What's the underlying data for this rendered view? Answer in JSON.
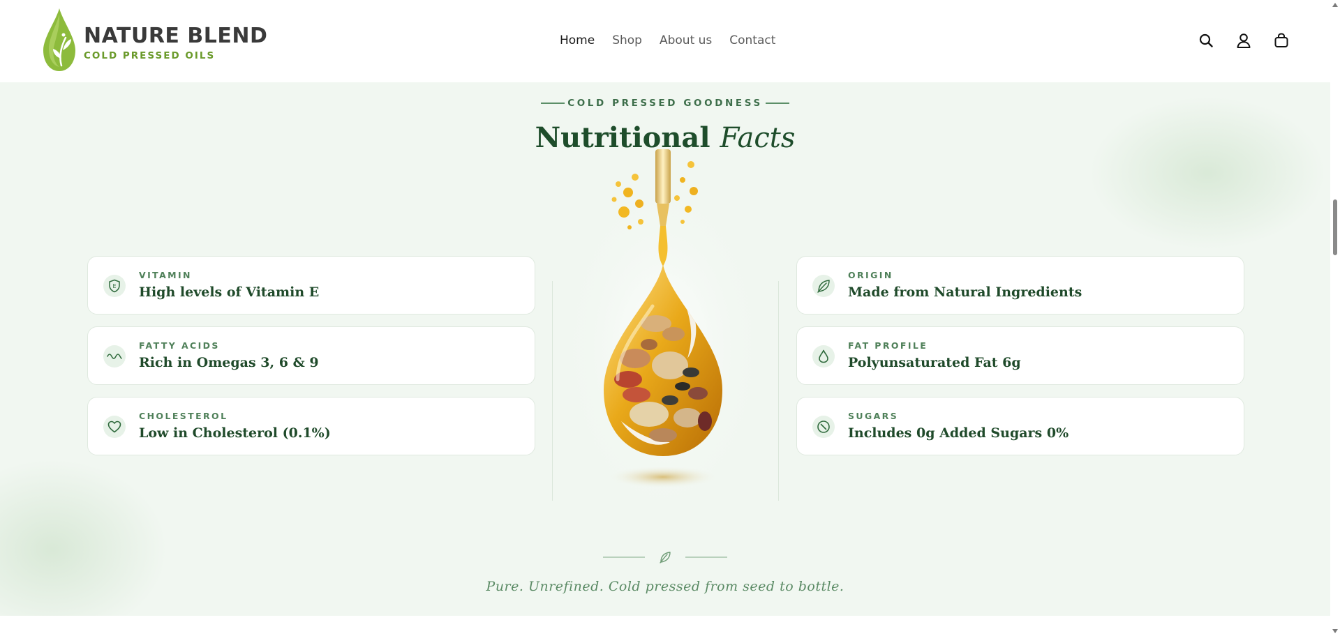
{
  "brand": {
    "name": "NATURE BLEND",
    "tagline": "COLD PRESSED OILS",
    "colors": {
      "green_dark": "#1e4d2b",
      "green_leaf": "#6a9a2a",
      "section_bg": "#f1f7f1"
    }
  },
  "nav": {
    "items": [
      {
        "label": "Home",
        "active": true
      },
      {
        "label": "Shop",
        "active": false
      },
      {
        "label": "About us",
        "active": false
      },
      {
        "label": "Contact",
        "active": false
      }
    ]
  },
  "header_icons": [
    "search-icon",
    "account-icon",
    "cart-icon"
  ],
  "section": {
    "eyebrow": "COLD PRESSED GOODNESS",
    "title_main": "Nutritional",
    "title_italic": "Facts",
    "left_facts": [
      {
        "icon": "vitamin-e-shield-icon",
        "label": "VITAMIN",
        "value": "High levels of Vitamin E"
      },
      {
        "icon": "wave-icon",
        "label": "FATTY ACIDS",
        "value": "Rich in Omegas 3, 6 & 9"
      },
      {
        "icon": "heart-icon",
        "label": "CHOLESTEROL",
        "value": "Low in Cholesterol (0.1%)"
      }
    ],
    "right_facts": [
      {
        "icon": "leaf-icon",
        "label": "ORIGIN",
        "value": "Made from Natural Ingredients"
      },
      {
        "icon": "drop-icon",
        "label": "FAT PROFILE",
        "value": "Polyunsaturated Fat 6g"
      },
      {
        "icon": "no-sugar-icon",
        "label": "SUGARS",
        "value": "Includes 0g Added Sugars 0%"
      }
    ],
    "footer_tagline": "Pure. Unrefined. Cold pressed from seed to bottle."
  }
}
